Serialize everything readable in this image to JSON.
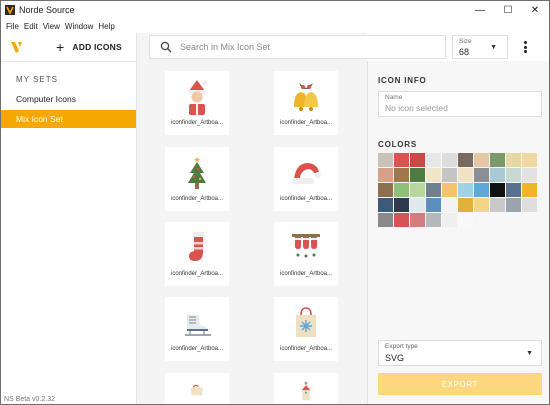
{
  "window": {
    "title": "Norde Source",
    "minimize": "—",
    "maximize": "☐",
    "close": "✕"
  },
  "menu": [
    "File",
    "Edit",
    "View",
    "Window",
    "Help"
  ],
  "toolbar": {
    "add_icons_label": "ADD ICONS"
  },
  "search": {
    "placeholder": "Search in Mix Icon Set"
  },
  "size": {
    "label": "Size",
    "value": "68"
  },
  "sidebar": {
    "sets_title": "MY SETS",
    "sets": [
      {
        "label": "Computer Icons",
        "active": false
      },
      {
        "label": "Mix Icon Set",
        "active": true
      }
    ],
    "version": "NS Beta v0.2.32"
  },
  "icons": [
    {
      "name": "santa-icon",
      "caption": "iconfinder_Artboa..."
    },
    {
      "name": "bells-icon",
      "caption": "iconfinder_Artboa..."
    },
    {
      "name": "christmas-tree-icon",
      "caption": "iconfinder_Artboa..."
    },
    {
      "name": "santa-hat-icon",
      "caption": "iconfinder_Artboa..."
    },
    {
      "name": "stocking-icon",
      "caption": "iconfinder_Artboa..."
    },
    {
      "name": "fireplace-icon",
      "caption": "iconfinder_Artboa..."
    },
    {
      "name": "ice-skate-icon",
      "caption": "iconfinder_Artboa..."
    },
    {
      "name": "gift-bag-icon",
      "caption": "iconfinder_Artboa..."
    },
    {
      "name": "sleigh-icon",
      "caption": ""
    },
    {
      "name": "church-icon",
      "caption": ""
    }
  ],
  "icon_info": {
    "title": "ICON INFO",
    "name_label": "Name",
    "name_placeholder": "No icon selected"
  },
  "colors": {
    "title": "COLORS",
    "swatches": [
      "#c9c2b7",
      "#d9534f",
      "#c94a44",
      "#e8e8e8",
      "#dcdcdc",
      "#7b6b5e",
      "#e5c7a6",
      "#7a9a6b",
      "#e6d7a5",
      "#efd9a0",
      "#d8a08a",
      "#a0764f",
      "#4e7b3f",
      "#efe6c7",
      "#c4c4c4",
      "#f1e2c4",
      "#8a8f96",
      "#a8c9d6",
      "#c9d8d2",
      "#e2e2e2",
      "#8c6f4c",
      "#8fc079",
      "#b6d89c",
      "#6e7f8f",
      "#f3c36b",
      "#9fd3e3",
      "#5fa6d9",
      "#111111",
      "#5b6f8f",
      "#f0b429",
      "#3e5a7a",
      "#2e3b4c",
      "#e0e8ee",
      "#5a8fbf",
      "#f3f3f3",
      "#e2b13c",
      "#f5d48a",
      "#c9c9c9",
      "#9aa4ad",
      "#dedede",
      "#8a8a8a",
      "#d45555",
      "#d07d7d",
      "#b5b9bd",
      "#efefef",
      "#f9f9f9"
    ]
  },
  "export": {
    "type_label": "Export type",
    "type_value": "SVG",
    "button_label": "EXPORT"
  },
  "accent": "#f5a800"
}
